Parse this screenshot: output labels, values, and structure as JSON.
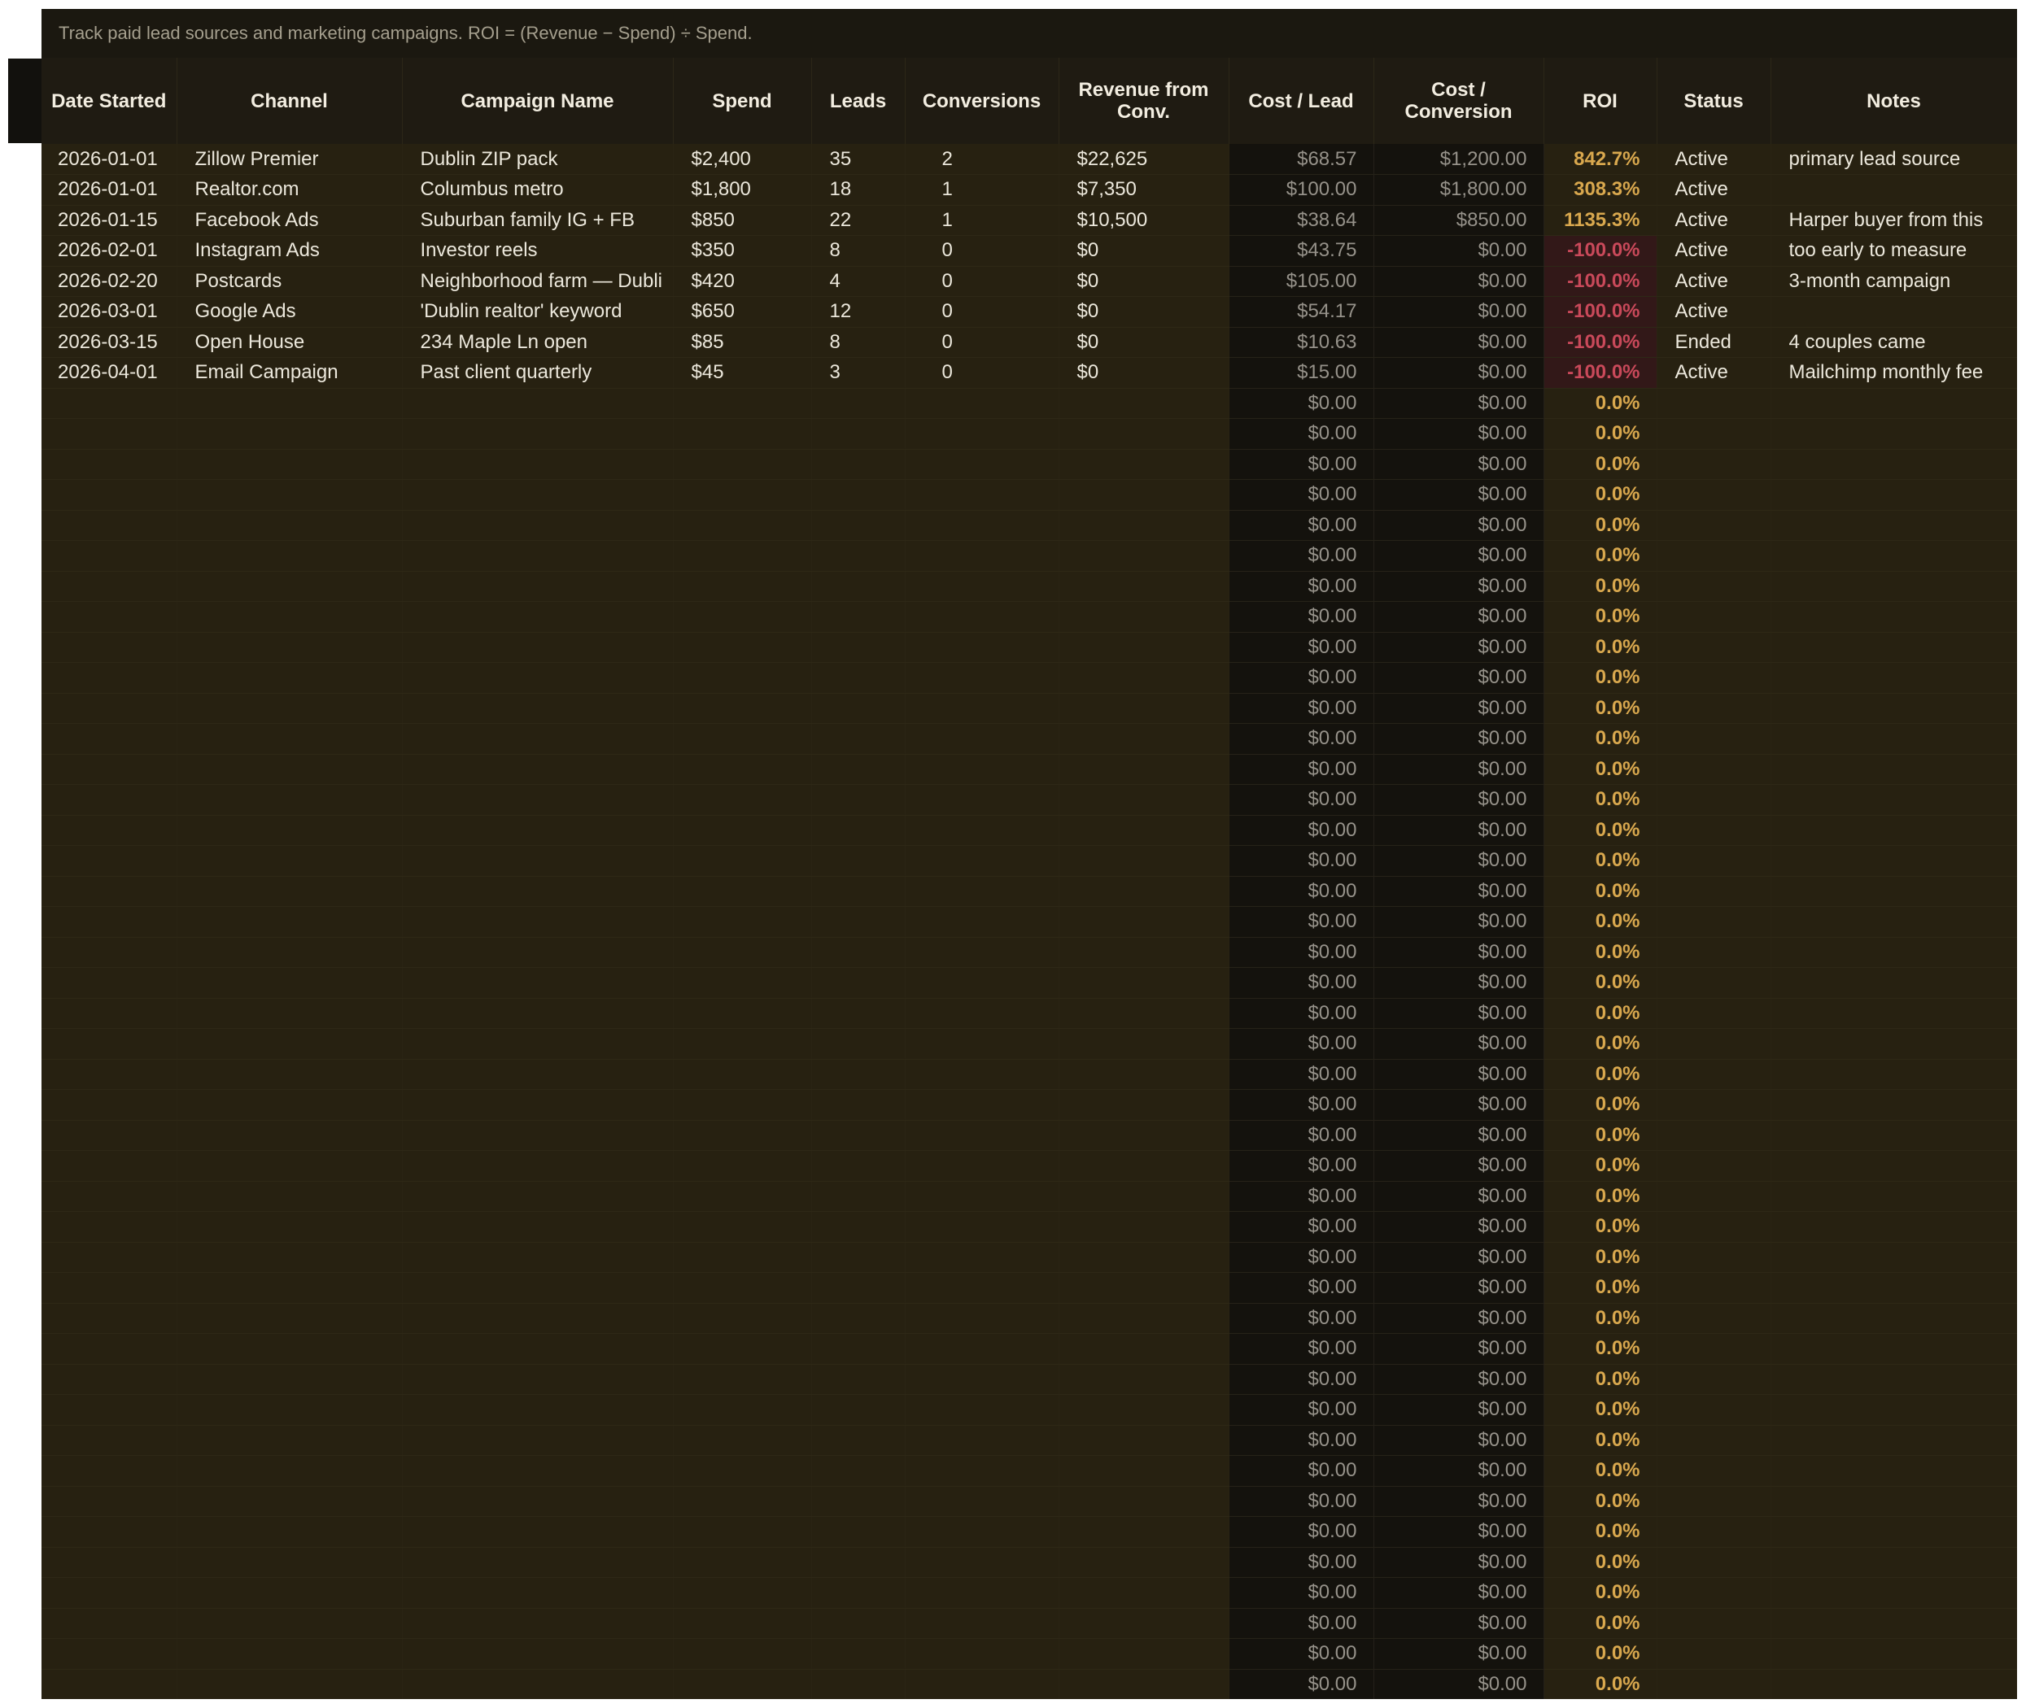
{
  "description": "Track paid lead sources and marketing campaigns. ROI = (Revenue − Spend) ÷ Spend.",
  "columns": [
    "Date Started",
    "Channel",
    "Campaign Name",
    "Spend",
    "Leads",
    "Conversions",
    "Revenue from Conv.",
    "Cost / Lead",
    "Cost / Conversion",
    "ROI",
    "Status",
    "Notes"
  ],
  "rows": [
    {
      "date": "2026-01-01",
      "channel": "Zillow Premier",
      "campaign": "Dublin ZIP pack",
      "spend": "$2,400",
      "leads": "35",
      "conversions": "2",
      "revenue": "$22,625",
      "cost_lead": "$68.57",
      "cost_conv": "$1,200.00",
      "roi": "842.7%",
      "status": "Active",
      "notes": "primary lead source"
    },
    {
      "date": "2026-01-01",
      "channel": "Realtor.com",
      "campaign": "Columbus metro",
      "spend": "$1,800",
      "leads": "18",
      "conversions": "1",
      "revenue": "$7,350",
      "cost_lead": "$100.00",
      "cost_conv": "$1,800.00",
      "roi": "308.3%",
      "status": "Active",
      "notes": ""
    },
    {
      "date": "2026-01-15",
      "channel": "Facebook Ads",
      "campaign": "Suburban family IG + FB",
      "spend": "$850",
      "leads": "22",
      "conversions": "1",
      "revenue": "$10,500",
      "cost_lead": "$38.64",
      "cost_conv": "$850.00",
      "roi": "1135.3%",
      "status": "Active",
      "notes": "Harper buyer from this"
    },
    {
      "date": "2026-02-01",
      "channel": "Instagram Ads",
      "campaign": "Investor reels",
      "spend": "$350",
      "leads": "8",
      "conversions": "0",
      "revenue": "$0",
      "cost_lead": "$43.75",
      "cost_conv": "$0.00",
      "roi": "-100.0%",
      "status": "Active",
      "notes": "too early to measure"
    },
    {
      "date": "2026-02-20",
      "channel": "Postcards",
      "campaign": "Neighborhood farm — Dubli",
      "spend": "$420",
      "leads": "4",
      "conversions": "0",
      "revenue": "$0",
      "cost_lead": "$105.00",
      "cost_conv": "$0.00",
      "roi": "-100.0%",
      "status": "Active",
      "notes": "3-month campaign"
    },
    {
      "date": "2026-03-01",
      "channel": "Google Ads",
      "campaign": "'Dublin realtor' keyword",
      "spend": "$650",
      "leads": "12",
      "conversions": "0",
      "revenue": "$0",
      "cost_lead": "$54.17",
      "cost_conv": "$0.00",
      "roi": "-100.0%",
      "status": "Active",
      "notes": ""
    },
    {
      "date": "2026-03-15",
      "channel": "Open House",
      "campaign": "234 Maple Ln open",
      "spend": "$85",
      "leads": "8",
      "conversions": "0",
      "revenue": "$0",
      "cost_lead": "$10.63",
      "cost_conv": "$0.00",
      "roi": "-100.0%",
      "status": "Ended",
      "notes": "4 couples came"
    },
    {
      "date": "2026-04-01",
      "channel": "Email Campaign",
      "campaign": "Past client quarterly",
      "spend": "$45",
      "leads": "3",
      "conversions": "0",
      "revenue": "$0",
      "cost_lead": "$15.00",
      "cost_conv": "$0.00",
      "roi": "-100.0%",
      "status": "Active",
      "notes": "Mailchimp monthly fee"
    }
  ],
  "empty_row_count": 43,
  "empty_row_values": {
    "cost_lead": "$0.00",
    "cost_conv": "$0.00",
    "roi": "0.0%"
  },
  "colors": {
    "sheet_background": "#272111",
    "header_background": "#1f1b12",
    "calc_column_background": "#14120d",
    "roi_positive": "#d9a84e",
    "roi_negative": "#c9495a",
    "roi_negative_background": "#321818"
  }
}
